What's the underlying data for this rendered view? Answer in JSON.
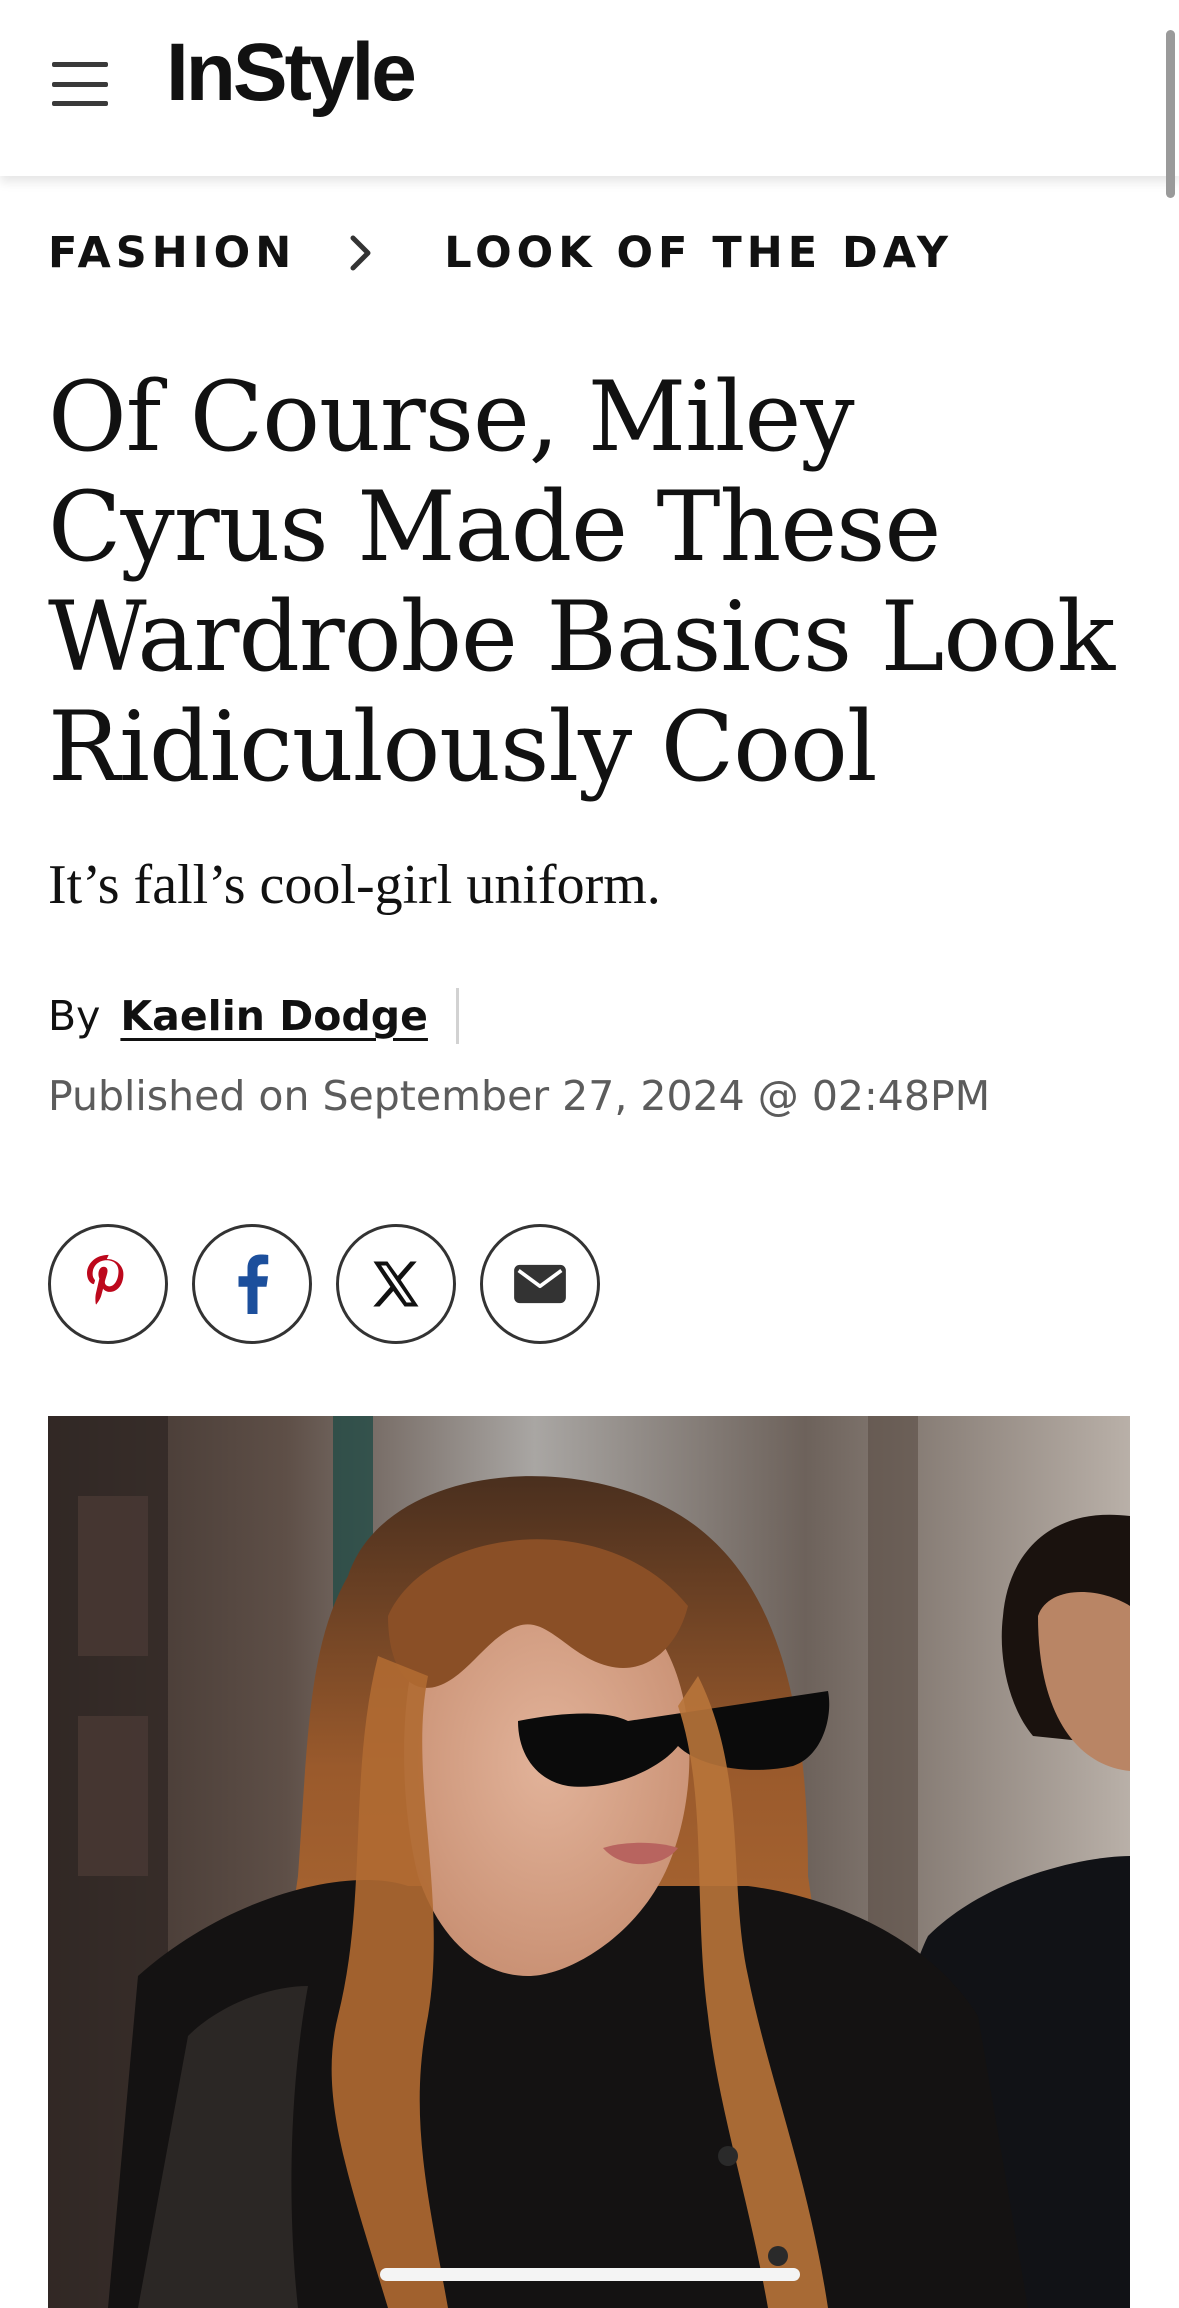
{
  "header": {
    "logo": "InStyle",
    "menu_icon": "hamburger-menu-icon"
  },
  "breadcrumb": {
    "items": [
      "FASHION",
      "LOOK OF THE DAY"
    ],
    "separator_icon": "chevron-right-icon"
  },
  "article": {
    "headline": "Of Course, Miley Cyrus Made These Wardrobe Basics Look Ridiculously Cool",
    "dek": "It’s fall’s cool-girl uniform.",
    "byline_prefix": "By",
    "author": "Kaelin Dodge",
    "published": "Published on September 27, 2024 @ 02:48PM"
  },
  "share": {
    "buttons": [
      {
        "icon": "pinterest-icon",
        "color": "#bd081c"
      },
      {
        "icon": "facebook-icon",
        "color": "#1c4f9c"
      },
      {
        "icon": "x-icon",
        "color": "#111111"
      },
      {
        "icon": "email-icon",
        "color": "#333333"
      }
    ]
  },
  "hero_image": {
    "subject": "photo-miley-cyrus"
  },
  "colors": {
    "text": "#111111",
    "meta_text": "#5c5c5c"
  }
}
